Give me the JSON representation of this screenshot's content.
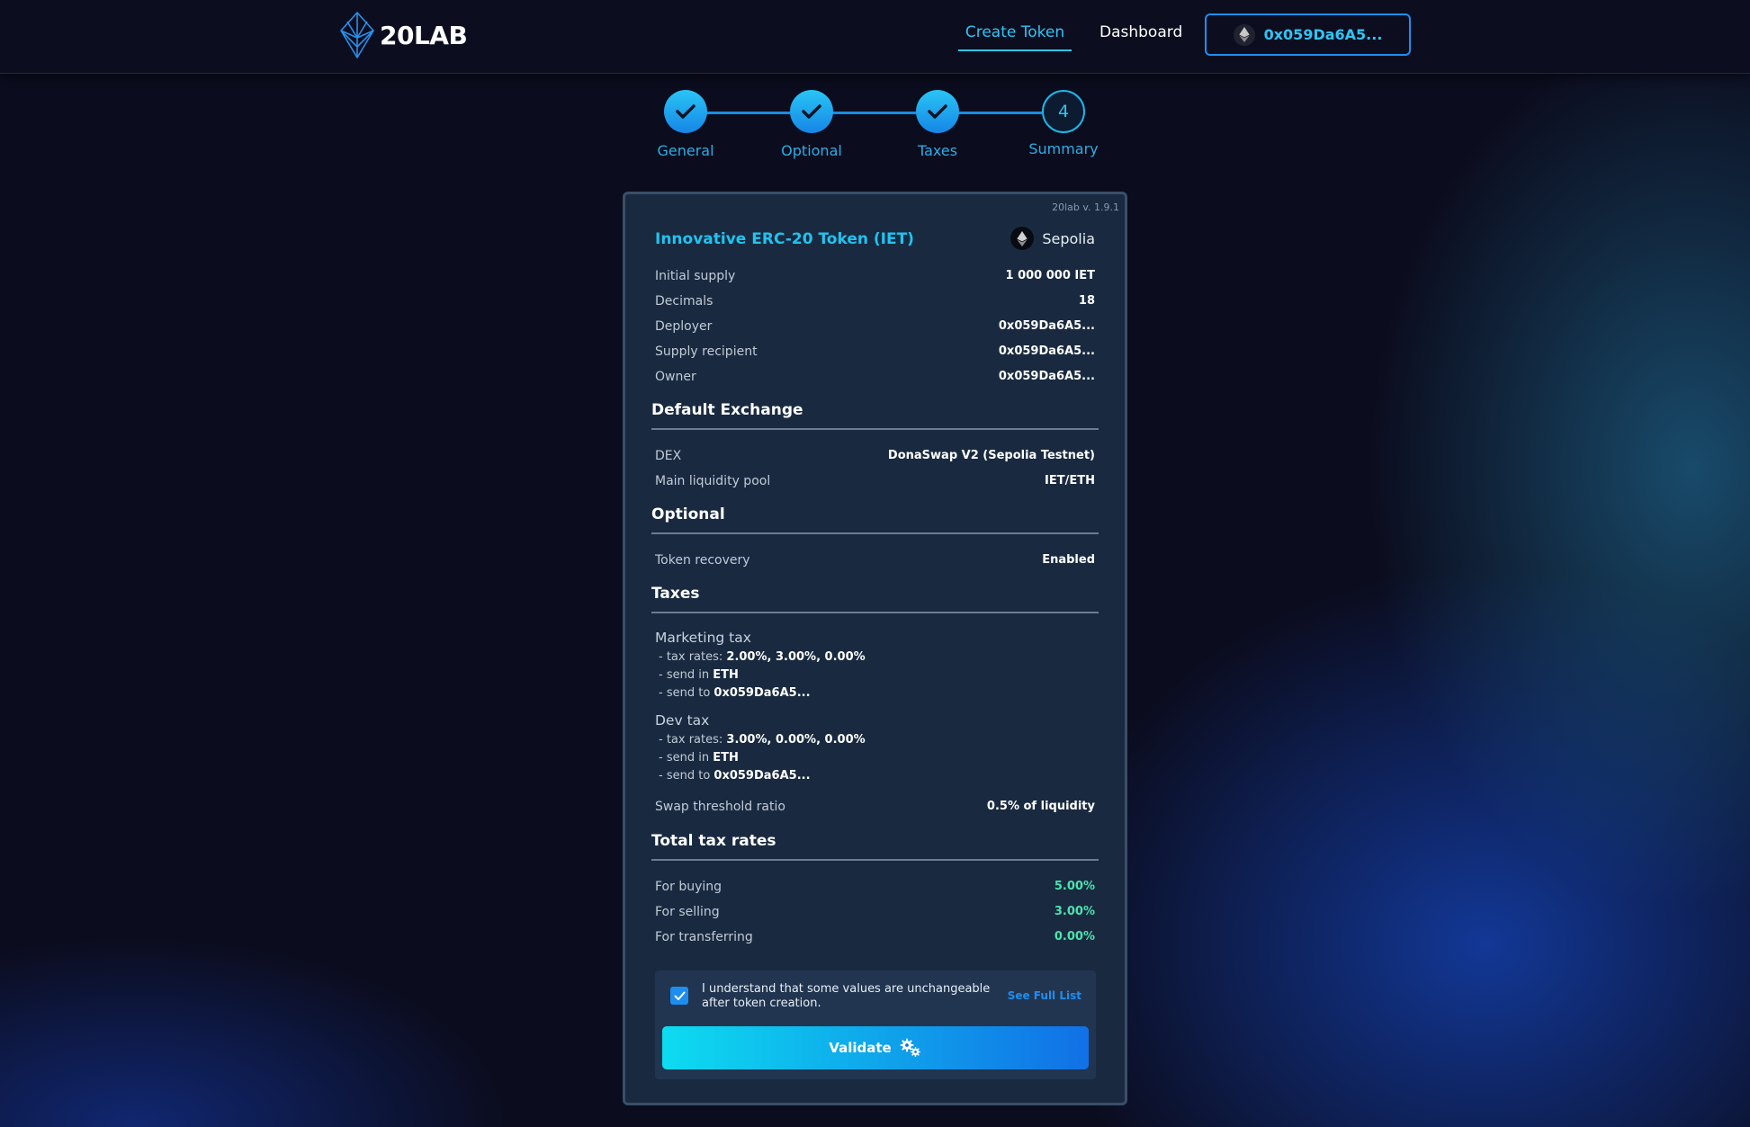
{
  "header": {
    "brand": "20LAB",
    "nav": {
      "create_token": "Create Token",
      "dashboard": "Dashboard"
    },
    "wallet_address": "0x059Da6A5..."
  },
  "stepper": {
    "steps": [
      {
        "label": "General",
        "state": "done"
      },
      {
        "label": "Optional",
        "state": "done"
      },
      {
        "label": "Taxes",
        "state": "done"
      },
      {
        "label": "Summary",
        "state": "current",
        "number": "4"
      }
    ]
  },
  "summary": {
    "version": "20lab v. 1.9.1",
    "token_title": "Innovative ERC-20 Token (IET)",
    "network": "Sepolia",
    "general": [
      {
        "label": "Initial supply",
        "value": "1 000 000 IET"
      },
      {
        "label": "Decimals",
        "value": "18"
      },
      {
        "label": "Deployer",
        "value": "0x059Da6A5..."
      },
      {
        "label": "Supply recipient",
        "value": "0x059Da6A5..."
      },
      {
        "label": "Owner",
        "value": "0x059Da6A5..."
      }
    ],
    "exchange": {
      "heading": "Default Exchange",
      "rows": [
        {
          "label": "DEX",
          "value": "DonaSwap V2 (Sepolia Testnet)"
        },
        {
          "label": "Main liquidity pool",
          "value": "IET/ETH"
        }
      ]
    },
    "optional": {
      "heading": "Optional",
      "rows": [
        {
          "label": "Token recovery",
          "value": "Enabled"
        }
      ]
    },
    "taxes": {
      "heading": "Taxes",
      "items": [
        {
          "name": "Marketing tax",
          "rates_prefix": "- tax rates: ",
          "rates": "2.00%, 3.00%, 0.00%",
          "send_in_prefix": "- send in ",
          "send_in": "ETH",
          "send_to_prefix": "- send to ",
          "send_to": "0x059Da6A5..."
        },
        {
          "name": "Dev tax",
          "rates_prefix": "- tax rates: ",
          "rates": "3.00%, 0.00%, 0.00%",
          "send_in_prefix": "- send in ",
          "send_in": "ETH",
          "send_to_prefix": "- send to ",
          "send_to": "0x059Da6A5..."
        }
      ],
      "swap_threshold_label": "Swap threshold ratio",
      "swap_threshold_value": "0.5% of liquidity"
    },
    "total": {
      "heading": "Total tax rates",
      "rows": [
        {
          "label": "For buying",
          "value": "5.00%"
        },
        {
          "label": "For selling",
          "value": "3.00%"
        },
        {
          "label": "For transferring",
          "value": "0.00%"
        }
      ]
    },
    "confirm": {
      "checked": true,
      "text": "I understand that some values are unchangeable after token creation.",
      "see_full_list": "See Full List",
      "validate_label": "Validate"
    }
  },
  "colors": {
    "accent": "#2ec5f5",
    "green": "#4be3ad",
    "card": "#192a40"
  }
}
